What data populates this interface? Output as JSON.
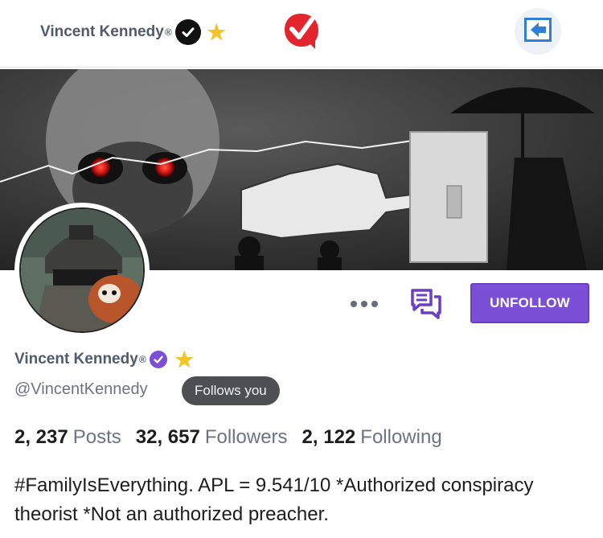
{
  "header": {
    "display_name": "Vincent Kennedy",
    "reg_mark": "®",
    "verified_icon": "verified-check-icon",
    "star_icon": "star-icon",
    "logo_icon": "app-logo-icon",
    "back_icon": "back-arrow-icon"
  },
  "banner": {
    "image_desc_icon": "banner-image"
  },
  "profile": {
    "display_name": "Vincent Kennedy",
    "reg_mark": "®",
    "handle": "@VincentKennedy",
    "follows_you": "Follows you",
    "stats": [
      {
        "value": "2, 237",
        "label": "Posts"
      },
      {
        "value": "32, 657",
        "label": "Followers"
      },
      {
        "value": "2, 122",
        "label": "Following"
      }
    ],
    "bio": "#FamilyIsEverything. APL = 9.541/10 *Authorized conspiracy theorist *Not an authorized preacher."
  },
  "actions": {
    "unfollow_label": "UNFOLLOW",
    "more_icon": "more-dots-icon",
    "message_icon": "message-icon"
  },
  "colors": {
    "accent": "#7b4fd6",
    "name_text": "#4f5a6e",
    "muted_text": "#6b7384",
    "pill_bg": "#4d4f53",
    "star": "#f5c425",
    "logo_red": "#e3262e"
  }
}
